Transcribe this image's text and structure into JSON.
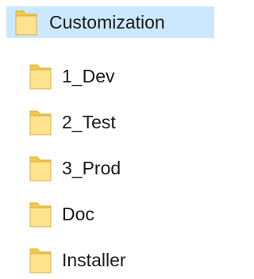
{
  "tree": {
    "root": {
      "label": "Customization",
      "icon": "folder-icon",
      "selected": true
    },
    "children": [
      {
        "label": "1_Dev",
        "icon": "folder-icon"
      },
      {
        "label": "2_Test",
        "icon": "folder-icon"
      },
      {
        "label": "3_Prod",
        "icon": "folder-icon"
      },
      {
        "label": "Doc",
        "icon": "folder-icon"
      },
      {
        "label": "Installer",
        "icon": "folder-icon"
      }
    ]
  },
  "colors": {
    "selection_bg": "#cce8ff",
    "folder_body": "#f6d36b",
    "folder_front": "#ffe89a",
    "folder_edge": "#dcb045",
    "text": "#1a1a1a"
  }
}
